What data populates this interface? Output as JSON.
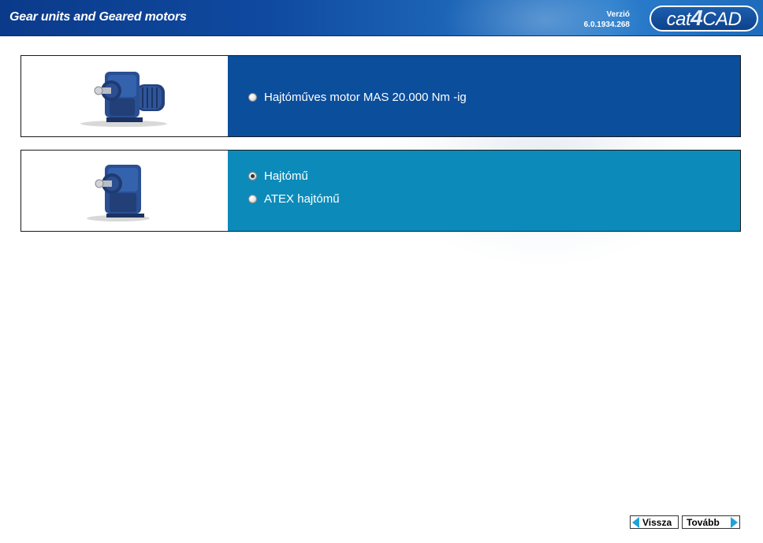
{
  "header": {
    "title": "Gear units and Geared motors",
    "version_label": "Verzió",
    "version_number": "6.0.1934.268",
    "logo_text_left": "cat",
    "logo_text_mid": "4",
    "logo_text_right": "CAD"
  },
  "options": [
    {
      "image": "gear-motor-with-motor",
      "choices": [
        {
          "label": "Hajtóműves motor MAS 20.000 Nm -ig",
          "selected": false
        }
      ]
    },
    {
      "image": "gear-unit",
      "choices": [
        {
          "label": "Hajtómű",
          "selected": true
        },
        {
          "label": "ATEX hajtómű",
          "selected": false
        }
      ]
    }
  ],
  "nav": {
    "back_label": "Vissza",
    "next_label": "Tovább"
  },
  "colors": {
    "header_blue": "#0f4aa0",
    "row1_panel": "#0b4e9c",
    "row2_panel": "#0c8bba",
    "nav_arrow": "#1fa2d8"
  }
}
